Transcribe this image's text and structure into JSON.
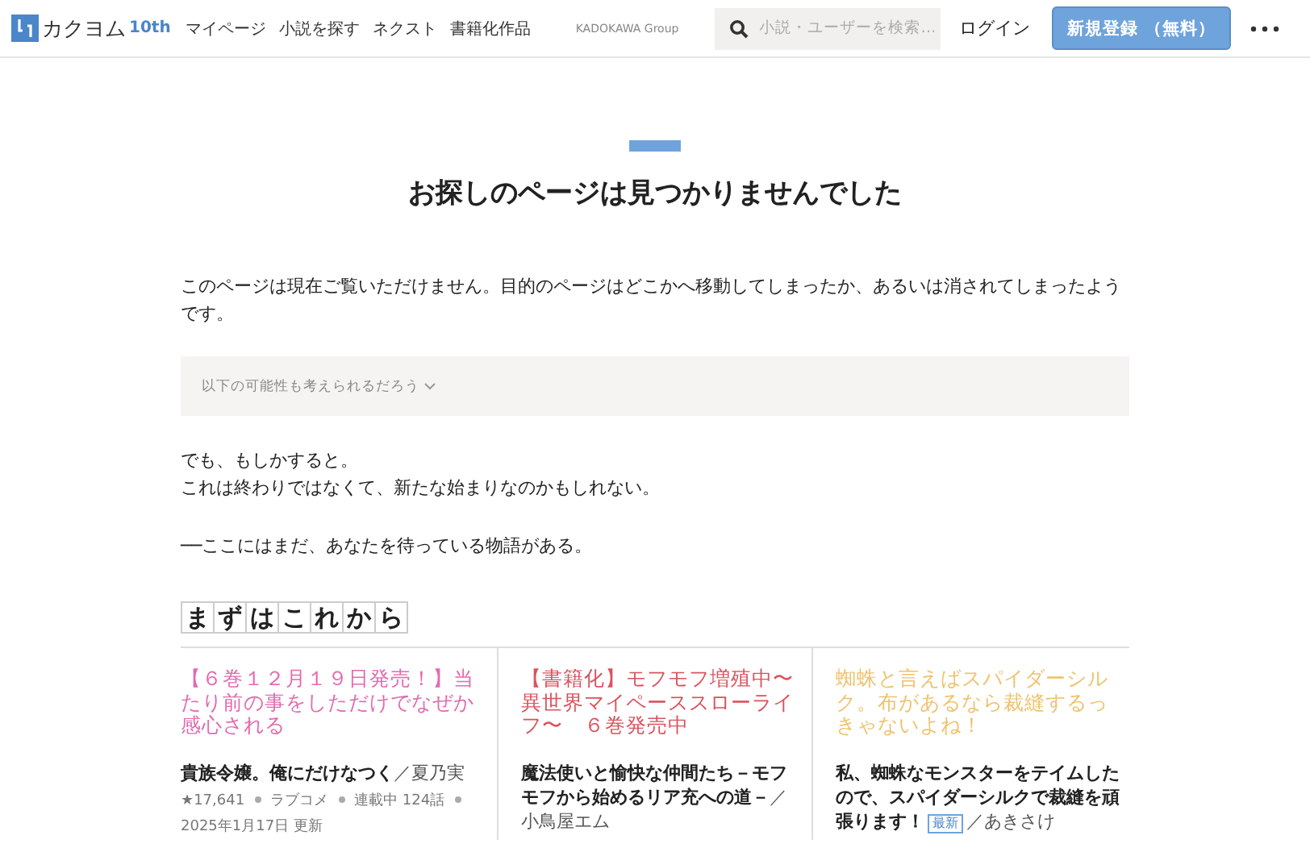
{
  "header": {
    "logo": {
      "name": "カクヨム",
      "badge": "10th"
    },
    "nav": [
      "マイページ",
      "小説を探す",
      "ネクスト",
      "書籍化作品"
    ],
    "group": "KADOKAWA Group",
    "search": {
      "placeholder": "小説・ユーザーを検索…"
    },
    "login": "ログイン",
    "signup": "新規登録 （無料）"
  },
  "heading": "お探しのページは見つかりませんでした",
  "message": "このページは現在ご覧いただけません。目的のページはどこかへ移動してしまったか、あるいは消されてしまったようです。",
  "possibilities": {
    "label": "以下の可能性も考えられるだろう",
    "expanded": false
  },
  "lines": [
    "でも、もしかすると。",
    "これは終わりではなくて、新たな始まりなのかもしれない。"
  ],
  "tagline": "──ここにはまだ、あなたを待っている物語がある。",
  "section_title": [
    "ま",
    "ず",
    "は",
    "こ",
    "れ",
    "か",
    "ら"
  ],
  "works": [
    {
      "catchphrase": "【６巻１２月１９日発売！】当たり前の事をしただけでなぜか感心される",
      "color": "#e26bb0",
      "title": "貴族令嬢。俺にだけなつく",
      "new": false,
      "author": "／夏乃実",
      "stats": [
        "★17,641",
        "ラブコメ",
        "連載中 124話",
        "2025年1月17日 更新"
      ]
    },
    {
      "catchphrase": "【書籍化】モフモフ増殖中〜異世界マイペーススローライフ〜　６巻発売中",
      "color": "#d9535e",
      "title": "魔法使いと愉快な仲間たち－モフモフから始めるリア充への道－",
      "new": false,
      "author": "／小鳥屋エム"
    },
    {
      "catchphrase": "蜘蛛と言えばスパイダーシルク。布があるなら裁縫するっきゃないよね！",
      "color": "#eec36d",
      "title": "私、蜘蛛なモンスターをテイムしたので、スパイダーシルクで裁縫を頑張ります！",
      "new": true,
      "badge": "最新",
      "author": "／あきさけ"
    }
  ]
}
